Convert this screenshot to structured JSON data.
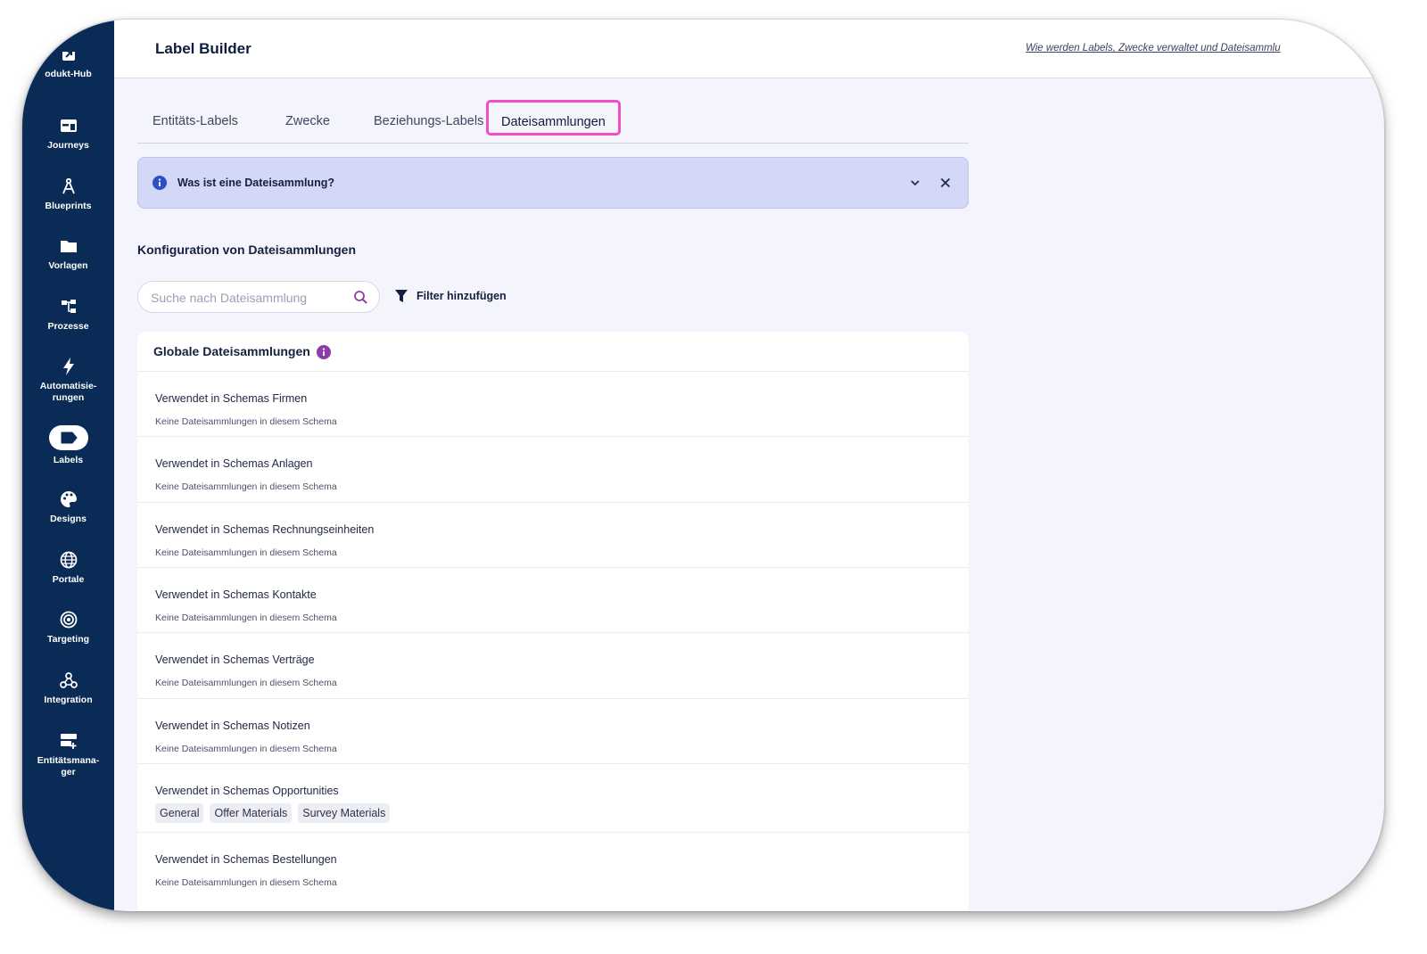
{
  "sidebar": {
    "items": [
      {
        "label": "odukt-Hub",
        "icon": "product-hub-icon"
      },
      {
        "label": "Journeys",
        "icon": "journeys-icon"
      },
      {
        "label": "Blueprints",
        "icon": "blueprints-icon"
      },
      {
        "label": "Vorlagen",
        "icon": "folder-icon"
      },
      {
        "label": "Prozesse",
        "icon": "processes-icon"
      },
      {
        "label": "Automatisie-\nrungen",
        "label_line1": "Automatisie-",
        "label_line2": "rungen",
        "icon": "lightning-icon"
      },
      {
        "label": "Labels",
        "icon": "label-tag-icon",
        "active": true
      },
      {
        "label": "Designs",
        "icon": "palette-icon"
      },
      {
        "label": "Portale",
        "icon": "globe-icon"
      },
      {
        "label": "Targeting",
        "icon": "target-icon"
      },
      {
        "label": "Integration",
        "icon": "webhook-icon"
      },
      {
        "label_line1": "Entitätsmana-",
        "label_line2": "ger",
        "icon": "entity-manager-icon"
      }
    ]
  },
  "header": {
    "title": "Label Builder",
    "help_link": "Wie werden Labels, Zwecke verwaltet und Dateisammlu"
  },
  "tabs": [
    {
      "label": "Entitäts-Labels"
    },
    {
      "label": "Zwecke"
    },
    {
      "label": "Beziehungs-Labels"
    },
    {
      "label": "Dateisammlungen",
      "active": true
    }
  ],
  "banner": {
    "text": "Was ist eine Dateisammlung?",
    "icon": "info-icon"
  },
  "section": {
    "title": "Konfiguration von Dateisammlungen"
  },
  "search": {
    "placeholder": "Suche nach Dateisammlung",
    "value": ""
  },
  "filter": {
    "label": "Filter hinzufügen"
  },
  "card": {
    "title": "Globale Dateisammlungen",
    "rows": [
      {
        "title": "Verwendet in Schemas Firmen",
        "subtitle": "Keine Dateisammlungen in diesem Schema"
      },
      {
        "title": "Verwendet in Schemas Anlagen",
        "subtitle": "Keine Dateisammlungen in diesem Schema"
      },
      {
        "title": "Verwendet in Schemas Rechnungseinheiten",
        "subtitle": "Keine Dateisammlungen in diesem Schema"
      },
      {
        "title": "Verwendet in Schemas Kontakte",
        "subtitle": "Keine Dateisammlungen in diesem Schema"
      },
      {
        "title": "Verwendet in Schemas Verträge",
        "subtitle": "Keine Dateisammlungen in diesem Schema"
      },
      {
        "title": "Verwendet in Schemas Notizen",
        "subtitle": "Keine Dateisammlungen in diesem Schema"
      },
      {
        "title": "Verwendet in Schemas Opportunities",
        "tags": [
          "General",
          "Offer Materials",
          "Survey Materials"
        ]
      },
      {
        "title": "Verwendet in Schemas Bestellungen",
        "subtitle": "Keine Dateisammlungen in diesem Schema"
      }
    ]
  },
  "colors": {
    "sidebar_bg": "#0b2b57",
    "active_tab_outline": "#f04fc8",
    "banner_bg": "#d3d8f7",
    "accent_purple": "#8b3fa6"
  }
}
